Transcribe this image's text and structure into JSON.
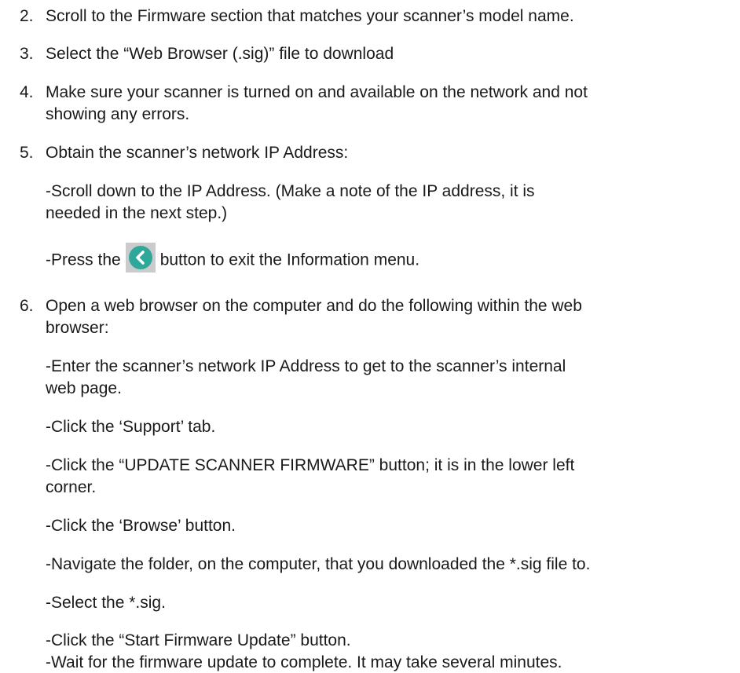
{
  "icons": {
    "back_icon": "chevron-left-icon",
    "back_icon_color": "#2fa89a",
    "back_icon_bg": "#c9cbcc"
  },
  "steps": {
    "s2": {
      "num": "2.",
      "text": "Scroll to the Firmware section that matches your scanner’s model name."
    },
    "s3": {
      "num": "3.",
      "text": "Select the “Web Browser (.sig)” file to download"
    },
    "s4": {
      "num": "4.",
      "line1": "Make sure your scanner is turned on and available on the network and not",
      "line2": "showing any errors."
    },
    "s5": {
      "num": "5.",
      "text": "Obtain the scanner’s network IP Address:",
      "sub1_line1": "-Scroll down to the IP Address. (Make a note of the IP address, it is",
      "sub1_line2": "needed in the next step.)",
      "sub2_before": "-Press the",
      "sub2_after": "button to exit the Information menu."
    },
    "s6": {
      "num": "6.",
      "line1": "Open a web browser on the computer and do the following within the web",
      "line2": "browser:",
      "sub1_line1": "-Enter the scanner’s network IP Address to get to the scanner’s internal",
      "sub1_line2": "web page.",
      "sub2": "-Click the ‘Support’ tab.",
      "sub3_line1": "-Click the “UPDATE SCANNER FIRMWARE” button; it is in the lower left",
      "sub3_line2": "corner.",
      "sub4": "-Click the ‘Browse’ button.",
      "sub5": "-Navigate the folder, on the computer, that you downloaded the *.sig file to.",
      "sub6": "-Select the *.sig.",
      "sub7": "-Click the “Start Firmware Update” button.",
      "sub8": "-Wait for the firmware update to complete. It may take several minutes."
    }
  }
}
